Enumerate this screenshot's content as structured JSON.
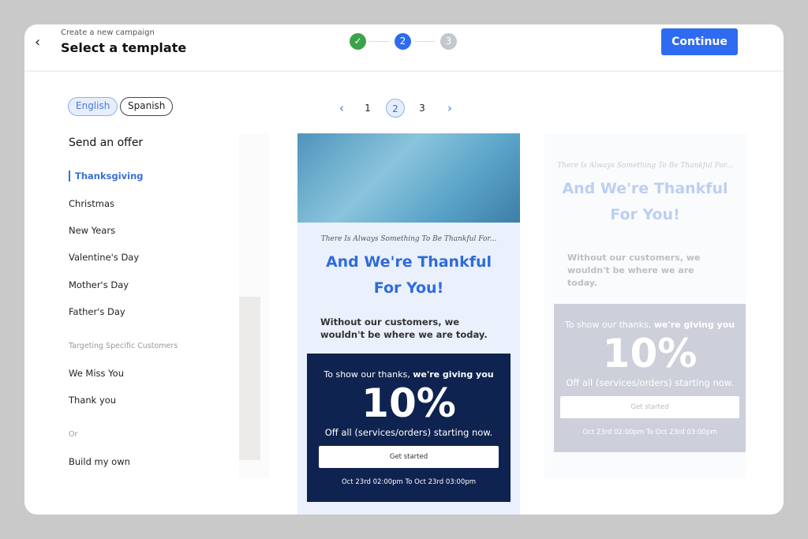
{
  "header": {
    "back_icon": "chevron-left-icon",
    "subtitle": "Create a new campaign",
    "title": "Select a template",
    "steps": [
      {
        "label": "✓",
        "state": "done",
        "color": "#3aa34a"
      },
      {
        "label": "2",
        "state": "current",
        "color": "#2f6bf0"
      },
      {
        "label": "3",
        "state": "upcoming",
        "color": "#c4c7cc"
      }
    ],
    "continue_label": "Continue"
  },
  "languages": [
    {
      "label": "English",
      "selected": true
    },
    {
      "label": "Spanish",
      "selected": false
    }
  ],
  "pagination": {
    "prev_icon": "chevron-left-icon",
    "pages": [
      "1",
      "2",
      "3"
    ],
    "current": "2",
    "next_icon": "chevron-right-icon"
  },
  "sidebar": {
    "heading": "Send an offer",
    "items": [
      "Thanksgiving",
      "Christmas",
      "New Years",
      "Valentine's Day",
      "Mother's Day",
      "Father's Day"
    ],
    "group2": "Targeting Specific Customers",
    "items2": [
      "We Miss You",
      "Thank you"
    ],
    "group3": "Or",
    "items3": [
      "Build my own"
    ],
    "active": "Thanksgiving"
  },
  "template": {
    "script": "There Is Always Something To Be Thankful For...",
    "headline1": "And We're Thankful",
    "headline2": "For You!",
    "body": "Without our customers, we wouldn't be where we are today.",
    "offer_intro": "To show our thanks, ",
    "offer_intro_bold": "we're giving you",
    "discount": "10%",
    "offer_detail": "Off all (services/orders) starting now.",
    "cta": "Get started",
    "dates": "Oct 23rd 02:00pm To Oct 23rd 03:00pm"
  }
}
